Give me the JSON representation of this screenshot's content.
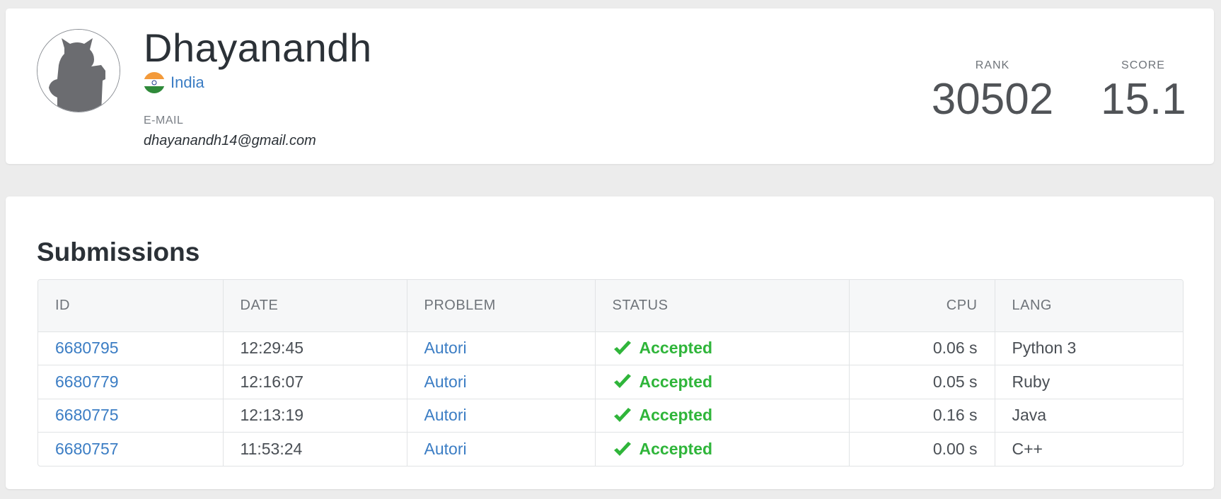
{
  "profile": {
    "name": "Dhayanandh",
    "country": "India",
    "email_label": "E-MAIL",
    "email": "dhayanandh14@gmail.com",
    "rank_label": "RANK",
    "rank": "30502",
    "score_label": "SCORE",
    "score": "15.1",
    "avatar_icon": "default-avatar-silhouette",
    "flag_icon": "india-flag"
  },
  "submissions": {
    "title": "Submissions",
    "columns": {
      "id": "ID",
      "date": "DATE",
      "problem": "PROBLEM",
      "status": "STATUS",
      "cpu": "CPU",
      "lang": "LANG"
    },
    "rows": [
      {
        "id": "6680795",
        "date": "12:29:45",
        "problem": "Autori",
        "status": "Accepted",
        "cpu": "0.06 s",
        "lang": "Python 3"
      },
      {
        "id": "6680779",
        "date": "12:16:07",
        "problem": "Autori",
        "status": "Accepted",
        "cpu": "0.05 s",
        "lang": "Ruby"
      },
      {
        "id": "6680775",
        "date": "12:13:19",
        "problem": "Autori",
        "status": "Accepted",
        "cpu": "0.16 s",
        "lang": "Java"
      },
      {
        "id": "6680757",
        "date": "11:53:24",
        "problem": "Autori",
        "status": "Accepted",
        "cpu": "0.00 s",
        "lang": "C++"
      }
    ],
    "status_icon": "check-icon"
  },
  "colors": {
    "link": "#3b7dc4",
    "accepted": "#2fb53a",
    "background": "#ececec"
  }
}
